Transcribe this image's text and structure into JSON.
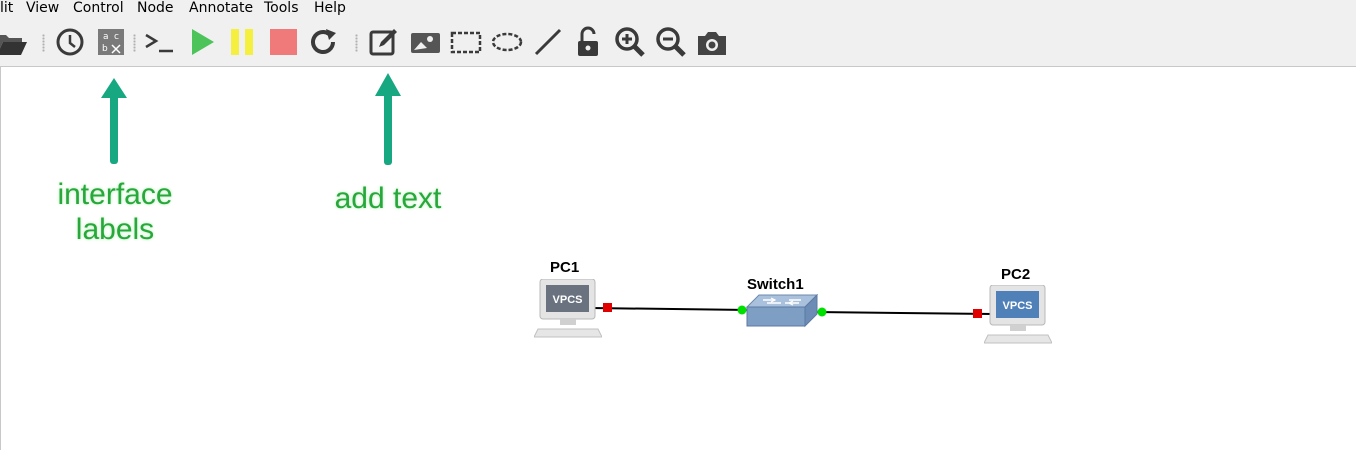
{
  "menu": {
    "items": [
      {
        "label": "lit"
      },
      {
        "label": "View"
      },
      {
        "label": "Control"
      },
      {
        "label": "Node"
      },
      {
        "label": "Annotate"
      },
      {
        "label": "Tools"
      },
      {
        "label": "Help"
      }
    ]
  },
  "toolbar": {
    "buttons": [
      {
        "icon": "folder-open-icon"
      },
      {
        "icon": "clock-icon"
      },
      {
        "icon": "interface-labels-icon"
      },
      {
        "icon": "console-icon"
      },
      {
        "icon": "play-icon"
      },
      {
        "icon": "pause-icon"
      },
      {
        "icon": "stop-icon"
      },
      {
        "icon": "reload-icon"
      },
      {
        "icon": "add-note-icon"
      },
      {
        "icon": "insert-picture-icon"
      },
      {
        "icon": "draw-rectangle-icon"
      },
      {
        "icon": "draw-ellipse-icon"
      },
      {
        "icon": "draw-line-icon"
      },
      {
        "icon": "unlock-icon"
      },
      {
        "icon": "zoom-in-icon"
      },
      {
        "icon": "zoom-out-icon"
      },
      {
        "icon": "screenshot-icon"
      }
    ]
  },
  "annotations": {
    "interface_labels": {
      "line1": "interface",
      "line2": "labels"
    },
    "add_text": "add text"
  },
  "topology": {
    "nodes": [
      {
        "name": "PC1",
        "badge": "VPCS"
      },
      {
        "name": "Switch1"
      },
      {
        "name": "PC2",
        "badge": "VPCS"
      }
    ]
  },
  "colors": {
    "annotation_green": "#26a83a",
    "arrow_teal": "#17a882",
    "link_up": "#00e000",
    "link_down": "#e00000"
  }
}
